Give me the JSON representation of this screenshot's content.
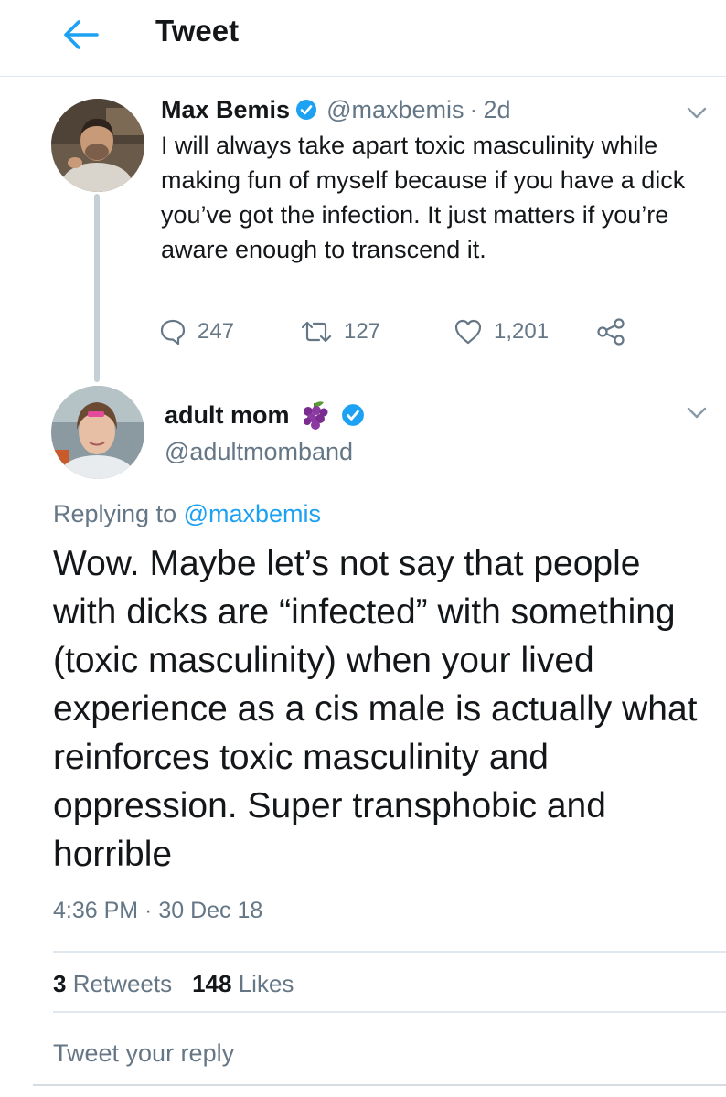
{
  "header": {
    "title": "Tweet"
  },
  "parent_tweet": {
    "name": "Max Bemis",
    "handle": "@maxbemis",
    "separator": "·",
    "time_ago": "2d",
    "text": "I will always take apart toxic masculinity while making fun of myself because if you have a dick you’ve got the infection. It just matters if you’re aware enough to transcend it.",
    "replies": "247",
    "retweets": "127",
    "likes": "1,201"
  },
  "main_tweet": {
    "name": "adult mom",
    "handle": "@adultmomband",
    "replying_prefix": "Replying to",
    "replying_to": "@maxbemis",
    "text": "Wow. Maybe let’s not say that people with dicks are “infected” with something (toxic masculinity) when your lived experience as a cis male is actually what reinforces toxic masculinity and oppression. Super transphobic and horrible",
    "timestamp": "4:36 PM · 30 Dec 18",
    "retweet_count": "3",
    "retweet_label": "Retweets",
    "like_count": "148",
    "like_label": "Likes"
  },
  "reply_box": {
    "placeholder": "Tweet your reply"
  },
  "icons": {
    "back": "arrow-left-icon",
    "verified": "verified-badge-icon",
    "chevron": "chevron-down-icon",
    "reply": "speech-bubble-icon",
    "retweet": "retweet-icon",
    "like": "heart-icon",
    "share": "share-icon",
    "emoji": "grapes-emoji-icon"
  },
  "colors": {
    "accent": "#1da1f2",
    "text_primary": "#14171a",
    "text_secondary": "#657786",
    "border": "#e1e8ed",
    "thread_line": "#c4cfd6",
    "grapes": "#7b2c8f"
  }
}
